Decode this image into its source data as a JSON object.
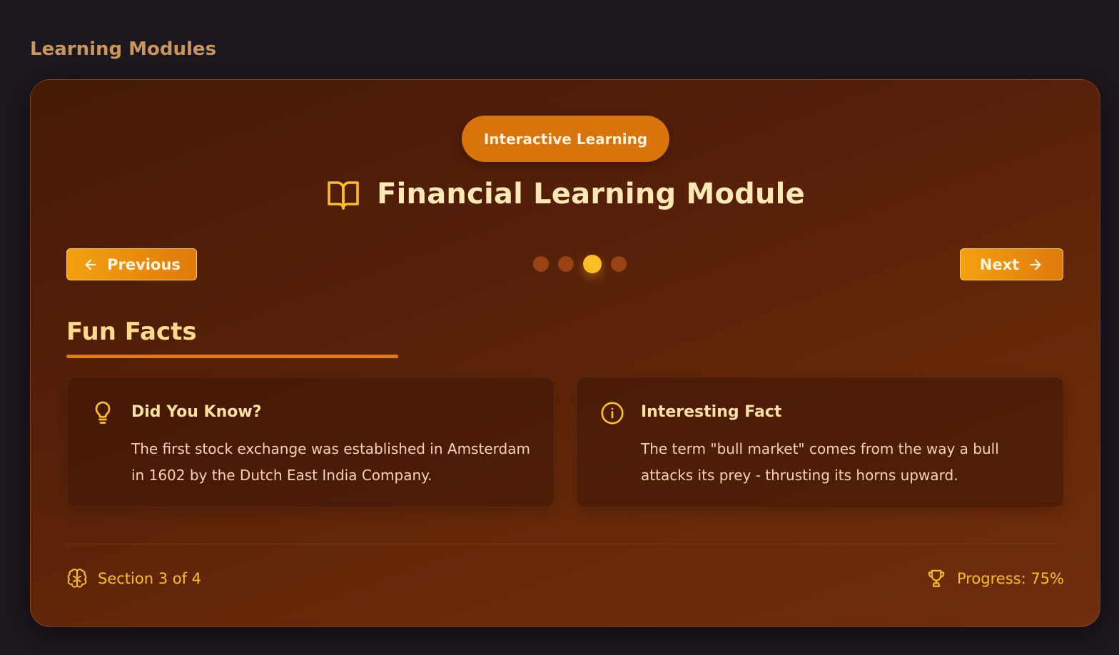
{
  "page": {
    "heading": "Learning Modules"
  },
  "module": {
    "badge": "Interactive Learning",
    "title": "Financial Learning Module",
    "title_icon": "book-open-icon"
  },
  "navigation": {
    "previous_label": "Previous",
    "previous_icon": "arrow-left-icon",
    "next_label": "Next",
    "next_icon": "arrow-right-icon",
    "total_steps": 4,
    "active_step": 3
  },
  "section": {
    "title": "Fun Facts",
    "facts": [
      {
        "icon": "lightbulb-icon",
        "title": "Did You Know?",
        "text": "The first stock exchange was established in Amsterdam in 1602 by the Dutch East India Company."
      },
      {
        "icon": "info-circle-icon",
        "title": "Interesting Fact",
        "text": "The term \"bull market\" comes from the way a bull attacks its prey - thrusting its horns upward."
      }
    ]
  },
  "footer": {
    "section_label": "Section 3 of 4",
    "section_icon": "brain-icon",
    "progress_label": "Progress: 75%",
    "progress_icon": "trophy-icon",
    "progress_percent": 75
  },
  "colors": {
    "accent": "#fbbf24",
    "button": "#f4a10f",
    "badge": "#d9740a",
    "background": "#1d1720",
    "card": "#551f09"
  }
}
